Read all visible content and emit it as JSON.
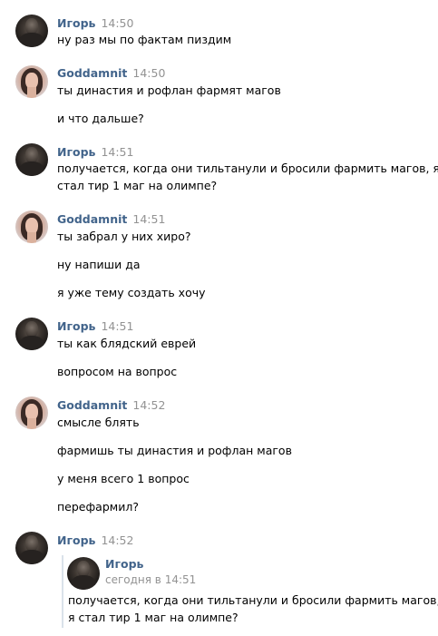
{
  "messages": [
    {
      "author": "Игорь",
      "time": "14:50",
      "avatar": "igor",
      "lines": [
        "ну раз мы по фактам пиздим"
      ]
    },
    {
      "author": "Goddamnit",
      "time": "14:50",
      "avatar": "goddamnit",
      "lines": [
        "ты династия и рофлан фармят магов",
        "и что дальше?"
      ]
    },
    {
      "author": "Игорь",
      "time": "14:51",
      "avatar": "igor",
      "lines": [
        "получается, когда они тильтанули и бросили фармить магов, я",
        "стал тир 1 маг на олимпе?"
      ]
    },
    {
      "author": "Goddamnit",
      "time": "14:51",
      "avatar": "goddamnit",
      "lines": [
        "ты забрал у них хиро?",
        "ну напиши да",
        "я уже тему создать хочу"
      ]
    },
    {
      "author": "Игорь",
      "time": "14:51",
      "avatar": "igor",
      "lines": [
        "ты как блядский еврей",
        "вопросом на вопрос"
      ]
    },
    {
      "author": "Goddamnit",
      "time": "14:52",
      "avatar": "goddamnit",
      "lines": [
        "смысле блять",
        "фармишь ты династия и рофлан магов",
        "у меня всего 1 вопрос",
        "перефармил?"
      ]
    },
    {
      "author": "Игорь",
      "time": "14:52",
      "avatar": "igor",
      "lines": []
    }
  ],
  "forwarded": {
    "author": "Игорь",
    "date_label": "сегодня в 14:51",
    "lines": [
      "получается, когда они тильтанули и бросили фармить магов,",
      "я стал тир 1 маг на олимпе?"
    ]
  },
  "colors": {
    "author_link": "#42648b",
    "timestamp": "#939393",
    "quote_border": "#dae2ea",
    "text": "#000000"
  }
}
